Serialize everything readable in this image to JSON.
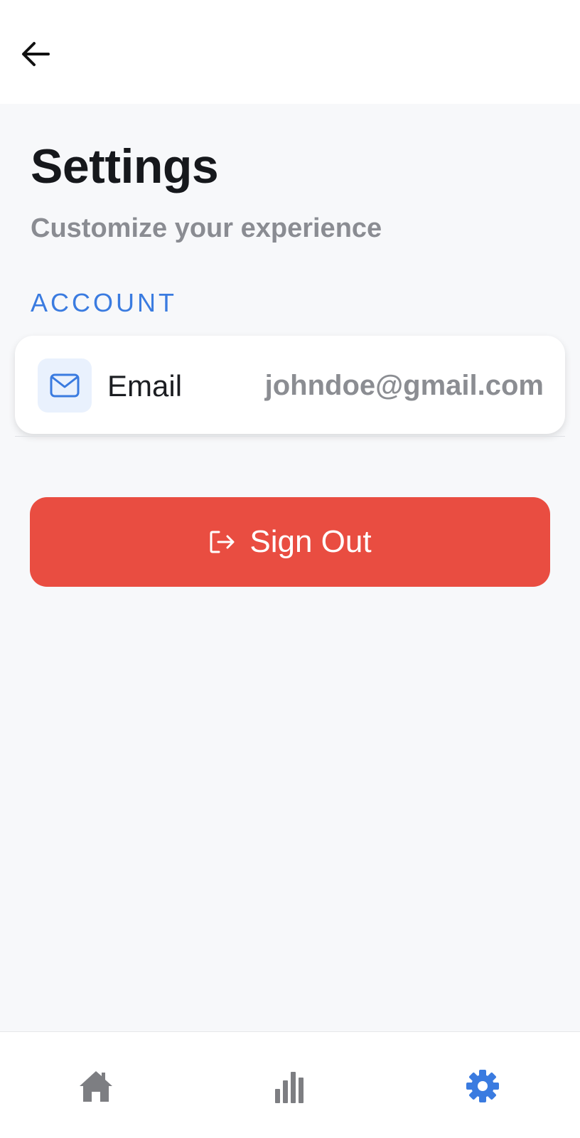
{
  "header": {
    "back_icon": "arrow-left-icon"
  },
  "page": {
    "title": "Settings",
    "subtitle": "Customize your experience"
  },
  "sections": [
    {
      "label": "ACCOUNT",
      "items": [
        {
          "icon": "mail-icon",
          "label": "Email",
          "value": "johndoe@gmail.com"
        }
      ]
    }
  ],
  "signout": {
    "icon": "logout-icon",
    "label": "Sign Out",
    "color": "#e94d41"
  },
  "bottom_nav": {
    "items": [
      {
        "name": "home",
        "icon": "home-icon",
        "active": false
      },
      {
        "name": "stats",
        "icon": "bar-chart-icon",
        "active": false
      },
      {
        "name": "settings",
        "icon": "gear-icon",
        "active": true
      }
    ]
  },
  "colors": {
    "accent": "#3a7be0",
    "danger": "#e94d41",
    "inactive_icon": "#7d7e82"
  }
}
